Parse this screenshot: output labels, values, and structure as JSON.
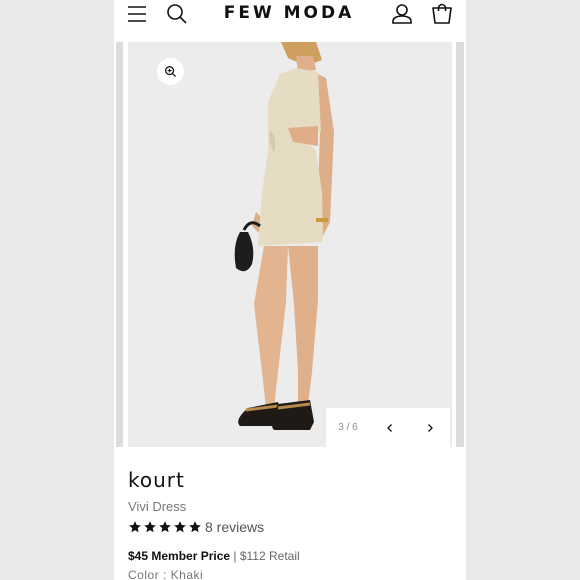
{
  "header": {
    "logo": "FEW MODA",
    "icons": [
      "menu-icon",
      "search-icon",
      "account-icon",
      "cart-icon"
    ]
  },
  "gallery": {
    "counter": "3 / 6",
    "icons": [
      "zoom-icon",
      "chevron-left-icon",
      "chevron-right-icon"
    ]
  },
  "product": {
    "vendor": "kourt",
    "name": "Vivi Dress",
    "rating": 5,
    "reviews": "8 reviews",
    "member_price": "$45 Member Price",
    "retail_price": " | $112 Retail",
    "color": "Color : Khaki"
  },
  "colors": {
    "text": "#111111",
    "muted": "#777777",
    "slide_bg": "#ececec",
    "dress": "#e6dcc3"
  }
}
